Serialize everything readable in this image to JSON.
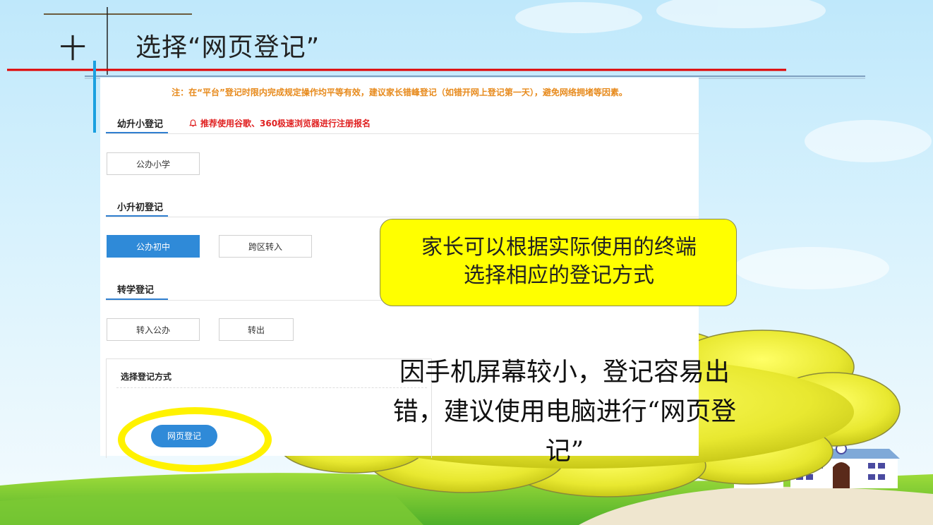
{
  "slide": {
    "number": "十",
    "title": "选择“网页登记”"
  },
  "panel": {
    "notice": "注：在“平台”登记时限内完成规定操作均平等有效，建议家长错峰登记（如错开网上登记第一天），避免网络拥堵等因素。",
    "recommend": "推荐使用谷歌、360极速浏览器进行注册报名",
    "sections": [
      {
        "title": "幼升小登记",
        "buttons": [
          "公办小学"
        ]
      },
      {
        "title": "小升初登记",
        "buttons": [
          "公办初中",
          "跨区转入"
        ],
        "active_button": "公办初中"
      },
      {
        "title": "转学登记",
        "buttons": [
          "转入公办",
          "转出"
        ]
      }
    ],
    "choose": {
      "title": "选择登记方式",
      "web_button": "网页登记"
    }
  },
  "callout": {
    "line1": "家长可以根据实际使用的终端",
    "line2": "选择相应的登记方式"
  },
  "cloud": {
    "line1": "因手机屏幕较小，登记容易出",
    "line2": "错，建议使用电脑进行“网页登",
    "line3": "记”"
  },
  "colors": {
    "accent_blue": "#2f8ad8",
    "callout_yellow": "#ffff00",
    "cloud_yellow": "#e0e020",
    "notice_orange": "#e78a1c",
    "recommend_red": "#e02020",
    "title_rule_red": "#e00000"
  },
  "icons": [
    "bell-icon",
    "cloud-shape",
    "house-illustration"
  ]
}
